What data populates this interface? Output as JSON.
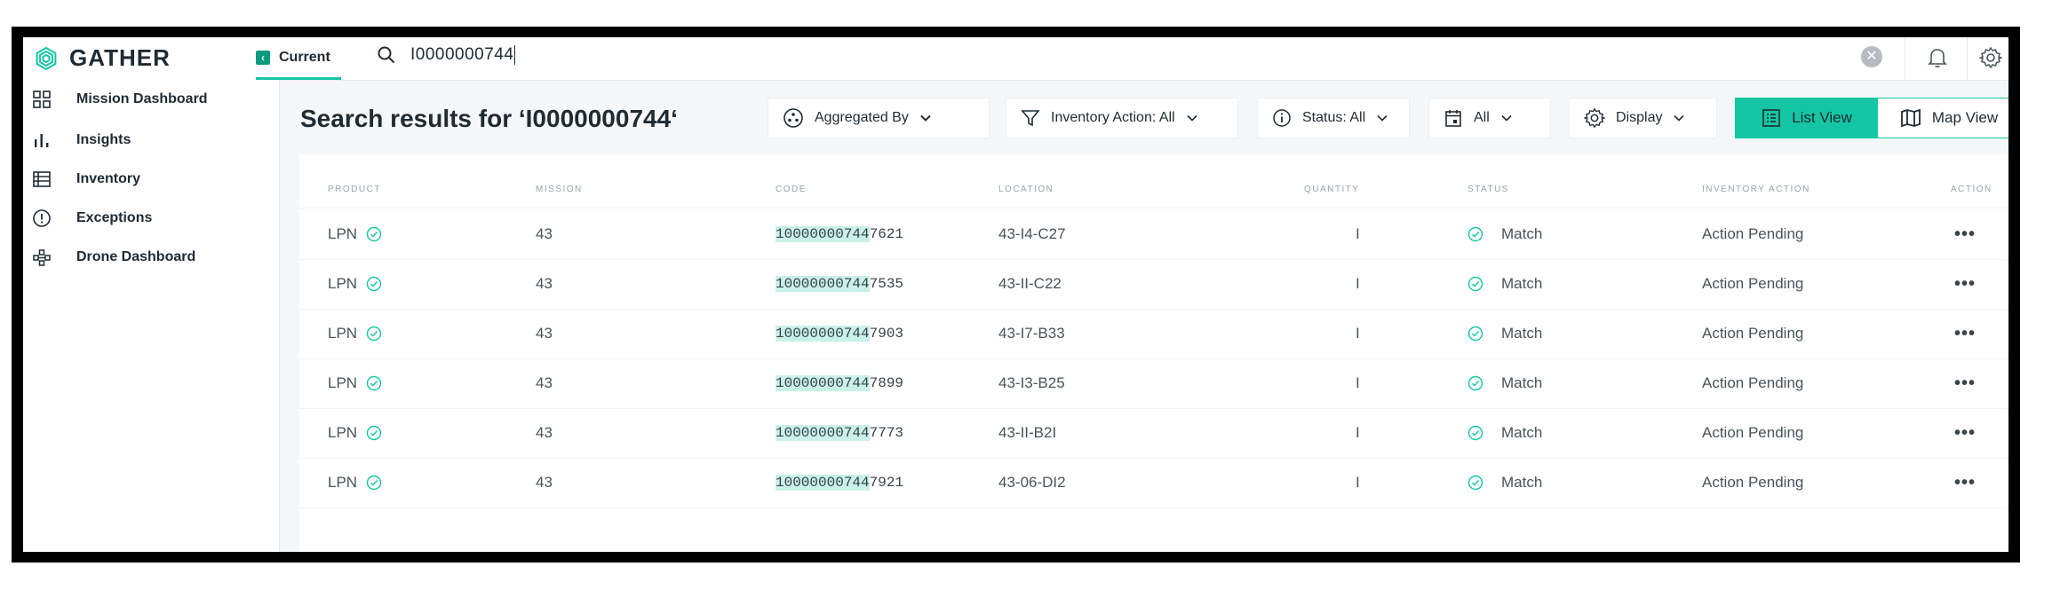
{
  "app": {
    "name": "GATHER"
  },
  "header": {
    "current_tab": "Current",
    "search_value": "I0000000744"
  },
  "sidebar": {
    "items": [
      {
        "label": "Mission Dashboard",
        "icon": "dashboard-icon"
      },
      {
        "label": "Insights",
        "icon": "bar-chart-icon"
      },
      {
        "label": "Inventory",
        "icon": "inventory-table-icon"
      },
      {
        "label": "Exceptions",
        "icon": "exclamation-circle-icon"
      },
      {
        "label": "Drone Dashboard",
        "icon": "drone-icon"
      }
    ]
  },
  "main": {
    "title": "Search results for ‘I0000000744‘",
    "toolbar": {
      "aggregated_by": "Aggregated By",
      "inventory_action": "Inventory Action: All",
      "status": "Status: All",
      "date": "All",
      "display": "Display",
      "list_view": "List View",
      "map_view": "Map View"
    },
    "columns": [
      "PRODUCT",
      "MISSION",
      "CODE",
      "LOCATION",
      "QUANTITY",
      "STATUS",
      "INVENTORY ACTION",
      "ACTION"
    ],
    "rows": [
      {
        "product": "LPN",
        "mission": "43",
        "code_match": "1000000074",
        "code_last_match": "4",
        "code_rest": "7621",
        "location": "43-I4-C27",
        "quantity": "I",
        "status": "Match",
        "inventory_action": "Action Pending",
        "action": "•••"
      },
      {
        "product": "LPN",
        "mission": "43",
        "code_match": "1000000074",
        "code_last_match": "4",
        "code_rest": "7535",
        "location": "43-II-C22",
        "quantity": "I",
        "status": "Match",
        "inventory_action": "Action Pending",
        "action": "•••"
      },
      {
        "product": "LPN",
        "mission": "43",
        "code_match": "1000000074",
        "code_last_match": "4",
        "code_rest": "7903",
        "location": "43-I7-B33",
        "quantity": "I",
        "status": "Match",
        "inventory_action": "Action Pending",
        "action": "•••"
      },
      {
        "product": "LPN",
        "mission": "43",
        "code_match": "1000000074",
        "code_last_match": "4",
        "code_rest": "7899",
        "location": "43-I3-B25",
        "quantity": "I",
        "status": "Match",
        "inventory_action": "Action Pending",
        "action": "•••"
      },
      {
        "product": "LPN",
        "mission": "43",
        "code_match": "1000000074",
        "code_last_match": "4",
        "code_rest": "7773",
        "location": "43-II-B2I",
        "quantity": "I",
        "status": "Match",
        "inventory_action": "Action Pending",
        "action": "•••"
      },
      {
        "product": "LPN",
        "mission": "43",
        "code_match": "1000000074",
        "code_last_match": "4",
        "code_rest": "7921",
        "location": "43-06-DI2",
        "quantity": "I",
        "status": "Match",
        "inventory_action": "Action Pending",
        "action": "•••"
      }
    ]
  },
  "colors": {
    "accent": "#14c6a3",
    "highlight": "#c9f1e8",
    "text": "#1f2b33",
    "frame": "#000000"
  }
}
